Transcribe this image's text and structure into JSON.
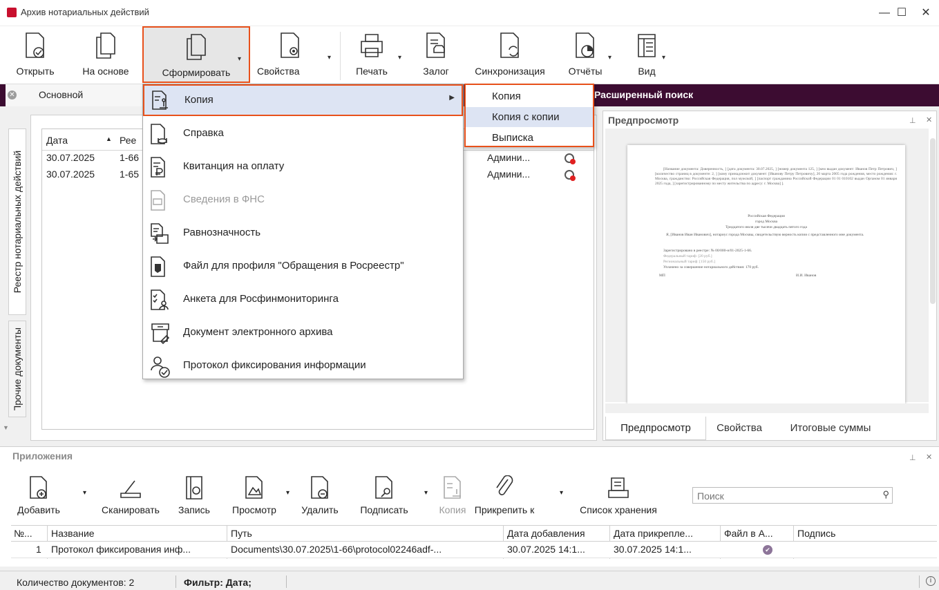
{
  "window": {
    "title": "Архив нотариальных действий",
    "minimize": "—",
    "maximize": "☐",
    "close": "✕"
  },
  "toolbar": {
    "open": "Открыть",
    "based_on": "На основе",
    "form": "Сформировать",
    "properties": "Свойства",
    "print": "Печать",
    "pledge": "Залог",
    "sync": "Синхронизация",
    "reports": "Отчёты",
    "view": "Вид"
  },
  "searchbar": {
    "tab": "Основной",
    "advanced": "Расширенный поиск"
  },
  "left_tabs": {
    "registry": "Реестр нотариальных действий",
    "other": "Прочие документы"
  },
  "registry": {
    "columns": [
      "Дата",
      "Рее"
    ],
    "rows": [
      {
        "date": "30.07.2025",
        "reg": "1-66",
        "user": "Админи..."
      },
      {
        "date": "30.07.2025",
        "reg": "1-65",
        "user": "Админи..."
      }
    ]
  },
  "menu": {
    "items": [
      {
        "label": "Копия",
        "disabled": false
      },
      {
        "label": "Справка",
        "disabled": false
      },
      {
        "label": "Квитанция на оплату",
        "disabled": false
      },
      {
        "label": "Сведения в ФНС",
        "disabled": true
      },
      {
        "label": "Равнозначность",
        "disabled": false
      },
      {
        "label": "Файл для профиля \"Обращения в Росреестр\"",
        "disabled": false
      },
      {
        "label": "Анкета для Росфинмониторинга",
        "disabled": false
      },
      {
        "label": "Документ электронного архива",
        "disabled": false
      },
      {
        "label": "Протокол фиксирования информации",
        "disabled": false
      }
    ]
  },
  "submenu": {
    "items": [
      "Копия",
      "Копия с копии",
      "Выписка"
    ]
  },
  "preview": {
    "title": "Предпросмотр",
    "tabs": [
      "Предпросмотр",
      "Свойства",
      "Итоговые суммы"
    ],
    "doc": {
      "para1": "[Название документа: Доверенность, ] [дата документа: 30.07.2025, ] [номер документа 125, ] [кем выдан документ: Иванов Петр Петрович, ] [количество страниц в документе: 2, ] [кому принадлежит документ: [Иванову Петру Петровичу], 20 марта 2005 года рождения, место рождения: г. Москва, гражданство: Российская Федерация, пол мужской, ] [паспорт гражданина Российской Федерации 01 01 010102 выдан Органом 01 января 2025 года, ] [зарегистрированному по месту жительства по адресу: г. Москва] ].",
      "country": "Российская Федерация",
      "city": "город Москва",
      "date_words": "Тридцатого июля две тысячи двадцать пятого года",
      "statement": "Я, [Иванов Иван Иванович], нотариус города Москвы, свидетельствую верность копии с представленного мне документа.",
      "reg": "Зарегистрировано в реестре: № 00/000-н/01-2025-1-66.",
      "fed": "Федеральный тариф: [20 руб.]",
      "reg_tariff": "Региональный тариф: [150 руб.]",
      "paid": "Уплачено за совершение нотариального действия: 170 руб.",
      "mp": "МП",
      "sign": "И.И. Иванов"
    }
  },
  "attachments": {
    "title": "Приложения",
    "buttons": {
      "add": "Добавить",
      "scan": "Сканировать",
      "record": "Запись",
      "view": "Просмотр",
      "delete": "Удалить",
      "sign": "Подписать",
      "copy": "Копия",
      "attach_to": "Прикрепить к",
      "storage_list": "Список хранения"
    },
    "search_placeholder": "Поиск",
    "columns": [
      "№...",
      "Название",
      "Путь",
      "Дата добавления",
      "Дата прикрепле...",
      "Файл в А...",
      "Подпись"
    ],
    "row": {
      "num": "1",
      "name": "Протокол фиксирования инф...",
      "path": "Documents\\30.07.2025\\1-66\\protocol02246adf-...",
      "added": "30.07.2025 14:1...",
      "attached": "30.07.2025 14:1..."
    }
  },
  "status": {
    "count": "Количество документов: 2",
    "filter": "Фильтр: Дата;"
  },
  "colors": {
    "accent": "#3c0c31",
    "highlight_border": "#e8501a",
    "menu_highlight": "#dde4f3"
  }
}
